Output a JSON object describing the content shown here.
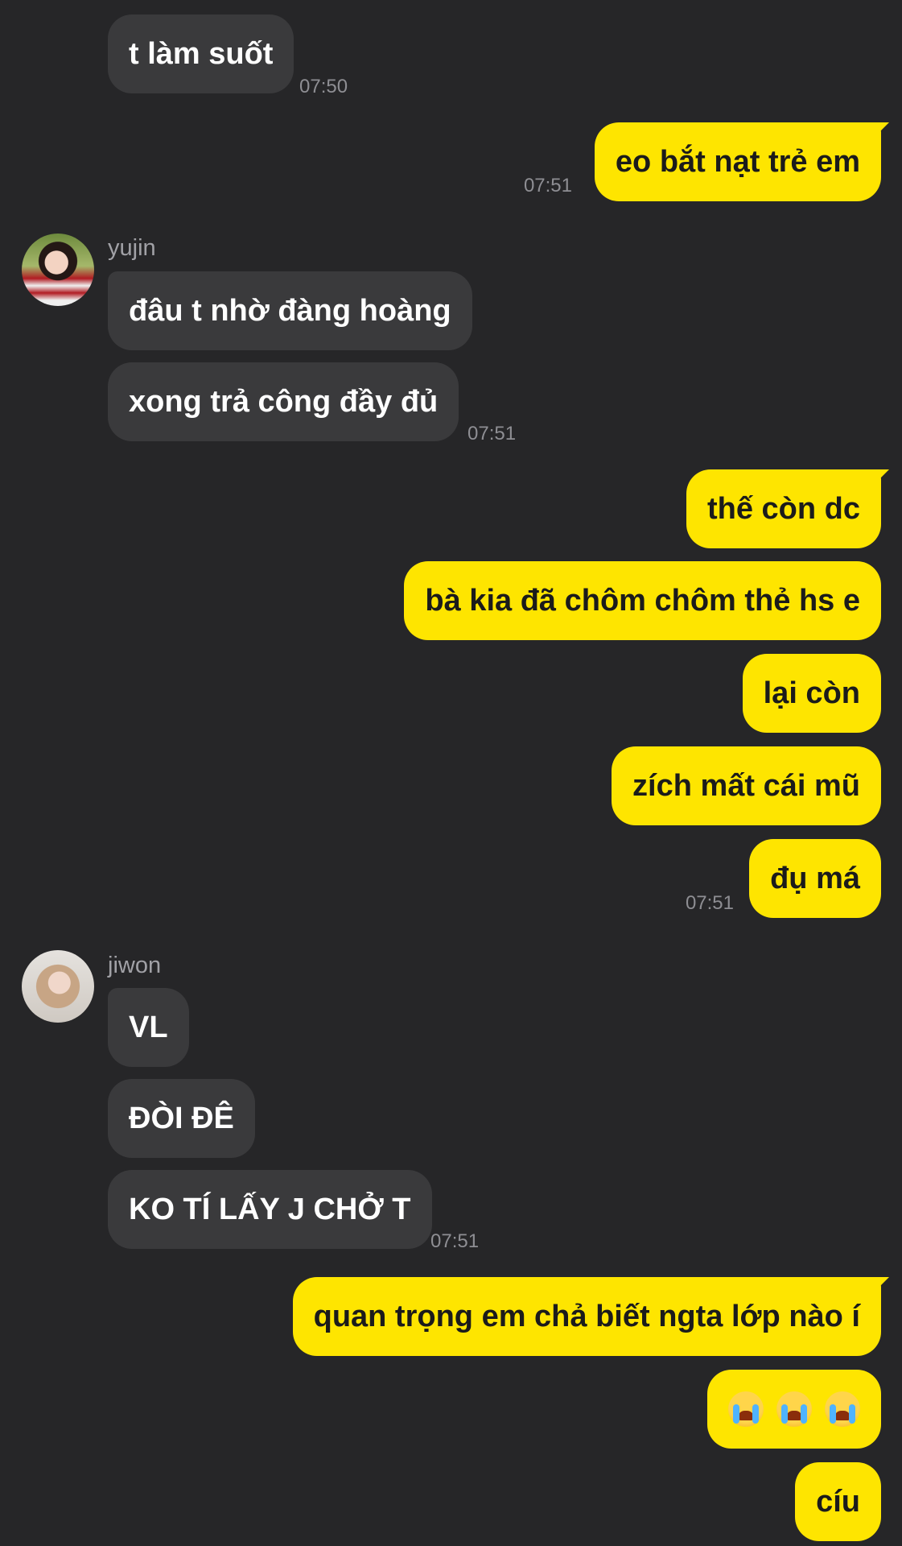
{
  "messages": [
    {
      "text": "t làm suốt",
      "time": "07:50"
    },
    {
      "text": "eo bắt nạt trẻ em",
      "time": "07:51"
    },
    {
      "sender": "yujin"
    },
    {
      "text": "đâu t nhờ đàng hoàng"
    },
    {
      "text": "xong trả công đầy đủ",
      "time": "07:51"
    },
    {
      "text": "thế còn dc"
    },
    {
      "text": "bà kia đã chôm chôm thẻ hs e"
    },
    {
      "text": "lại còn"
    },
    {
      "text": "zích mất cái mũ"
    },
    {
      "text": "đụ má",
      "time": "07:51"
    },
    {
      "sender": "jiwon"
    },
    {
      "text": "VL"
    },
    {
      "text": "ĐÒI ĐÊ"
    },
    {
      "text": "KO TÍ LẤY J CHỞ T",
      "time": "07:51"
    },
    {
      "text": "quan trọng em chả biết ngta lớp nào í"
    },
    {
      "text": "😭😭😭",
      "emoji": "loudly-crying-face",
      "count": 3
    },
    {
      "text": "cíu"
    }
  ],
  "colors": {
    "background": "#262628",
    "incoming_bubble": "#3a3a3c",
    "outgoing_bubble": "#fee500",
    "timestamp": "#8e8e93"
  }
}
